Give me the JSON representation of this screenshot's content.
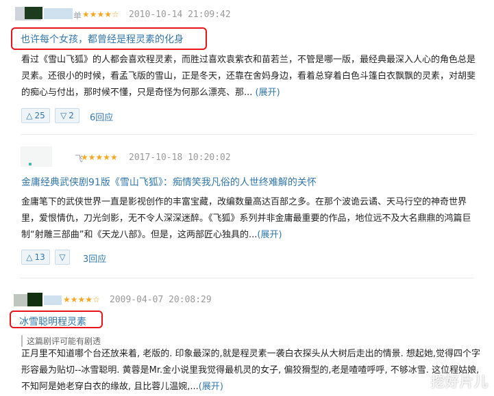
{
  "reviews": [
    {
      "username_partial": "单",
      "stars": "★★★★☆",
      "time": "2010-10-14 21:09:42",
      "title": "也许每个女孩，都曾经是程灵素的化身",
      "body_lines": [
        "看过《雪山飞狐》的人都会喜欢程灵素，而胜过喜欢袁紫衣和苗若兰，不管是哪一版，最经典最深入人心的角色总是",
        "灵素。还很小的时候，看孟飞版的雪山，正是冬天，还靠在舍妈身边，看着总穿着白色斗篷白衣飘飘的灵素，对胡斐",
        "的痴心与付出，那时候不懂，只是奇怪为何那么漂亮、那..."
      ],
      "more_label": "(展开)",
      "upvotes": "25",
      "downvotes": "2",
      "replies": "6回应"
    },
    {
      "username_partial": "飞",
      "stars": "★★★★★",
      "time": "2017-10-18 10:20:02",
      "title": "金庸经典武侠剧91版《雪山飞狐》：痴情笑我凡俗的人世终难解的关怀",
      "body_lines": [
        "金庸笔下的武侠世界一直是影视创作的丰富宝藏，改编数量高达百部之多。在那个波诡云谲、天马行空的神奇世界",
        "里，爱恨情仇，刀光剑影，无不令人深深迷醉。《飞狐》系列并非金庸最重要的作品，地位远不及大名鼎鼎的鸿篇巨",
        "制“射雕三部曲”和《天龙八部》。但是，这两部匠心独具的..."
      ],
      "more_label": "(展开)",
      "upvotes": "13",
      "downvotes": "",
      "replies": "3回应"
    },
    {
      "username_partial": "",
      "stars": "★★★★☆",
      "time": "2009-04-07 20:08:29",
      "title": "冰雪聪明程灵素",
      "spoiler": "这篇剧评可能有剧透",
      "body_lines": [
        "正月里不知道哪个台还放来着, 老版的. 印象最深的,就是程灵素一袭白衣探头从大树后走出的情景. 想起她,觉得四个字",
        "形容最为贴切--冰雪聪明. 黄蓉是Mr.金小说里我觉得最机灵的女子, 偏狡猾型的,老是喳喳呼呼, 不够冰雪. 这位程姑娘,",
        "不知阿是她老穿白衣的缘故, 且比蓉儿温婉,..."
      ],
      "more_label": "(展开)"
    }
  ],
  "watermark": "挖好片儿",
  "colors": {
    "link": "#3377aa",
    "star": "#f5a623",
    "highlight_box": "#e8121b"
  }
}
